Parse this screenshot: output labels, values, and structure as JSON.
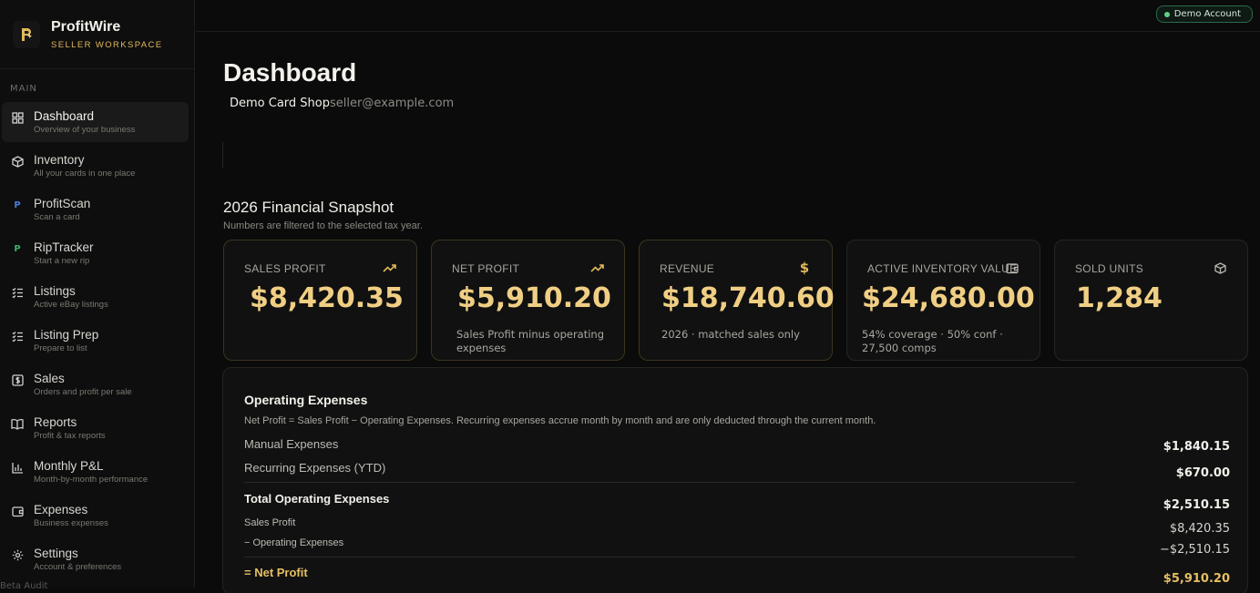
{
  "brand": {
    "name": "ProfitWire",
    "subtitle": "SELLER WORKSPACE"
  },
  "sidebar": {
    "section": "MAIN",
    "items": [
      {
        "label": "Dashboard",
        "sub": "Overview of your business",
        "icon": "grid-icon",
        "active": true
      },
      {
        "label": "Inventory",
        "sub": "All your cards in one place",
        "icon": "box-icon"
      },
      {
        "label": "ProfitScan",
        "sub": "Scan a card",
        "icon": "p-blue-icon"
      },
      {
        "label": "RipTracker",
        "sub": "Start a new rip",
        "icon": "p-green-icon"
      },
      {
        "label": "Listings",
        "sub": "Active eBay listings",
        "icon": "checklist-icon"
      },
      {
        "label": "Listing Prep",
        "sub": "Prepare to list",
        "icon": "checklist-icon"
      },
      {
        "label": "Sales",
        "sub": "Orders and profit per sale",
        "icon": "dollar-square-icon"
      },
      {
        "label": "Reports",
        "sub": "Profit & tax reports",
        "icon": "book-icon"
      },
      {
        "label": "Monthly P&L",
        "sub": "Month-by-month performance",
        "icon": "bar-chart-icon"
      },
      {
        "label": "Expenses",
        "sub": "Business expenses",
        "icon": "wallet-icon"
      },
      {
        "label": "Settings",
        "sub": "Account & preferences",
        "icon": "gear-icon"
      }
    ],
    "footer": "Beta Audit"
  },
  "topbar": {
    "badge": "Demo Account"
  },
  "page": {
    "title": "Dashboard",
    "shop_name": "Demo Card Shop",
    "email": "seller@example.com"
  },
  "snapshot": {
    "title": "2026 Financial Snapshot",
    "subtitle": "Numbers are filtered to the selected tax year.",
    "cards": [
      {
        "label": "SALES PROFIT",
        "value": "$8,420.35",
        "note": "",
        "icon": "trending-up-icon"
      },
      {
        "label": "NET PROFIT",
        "value": "$5,910.20",
        "note": "Sales Profit minus operating expenses",
        "icon": "trending-up-icon"
      },
      {
        "label": "REVENUE",
        "value": "$18,740.60",
        "note": "2026 · matched sales only",
        "icon": "dollar-icon"
      },
      {
        "label": "ACTIVE INVENTORY VALUE",
        "value": "$24,680.00",
        "note": "54% coverage · 50% conf · 27,500 comps",
        "icon": "wallet-icon"
      },
      {
        "label": "SOLD UNITS",
        "value": "1,284",
        "note": "",
        "icon": "box-icon"
      }
    ]
  },
  "expenses": {
    "title": "Operating Expenses",
    "description": "Net Profit = Sales Profit − Operating Expenses. Recurring expenses accrue month by month and are only deducted through the current month.",
    "manual_label": "Manual Expenses",
    "manual_value": "$1,840.15",
    "recurring_label": "Recurring Expenses (YTD)",
    "recurring_value": "$670.00",
    "total_label": "Total Operating Expenses",
    "total_value": "$2,510.15",
    "sales_profit_label": "Sales Profit",
    "sales_profit_value": "$8,420.35",
    "minus_label": "− Operating Expenses",
    "minus_value": "−$2,510.15",
    "net_label": "= Net Profit",
    "net_value": "$5,910.20"
  },
  "colors": {
    "accent": "#f0cf84",
    "brand_gold": "#e0b95c",
    "badge_green": "#5fcf8a"
  }
}
